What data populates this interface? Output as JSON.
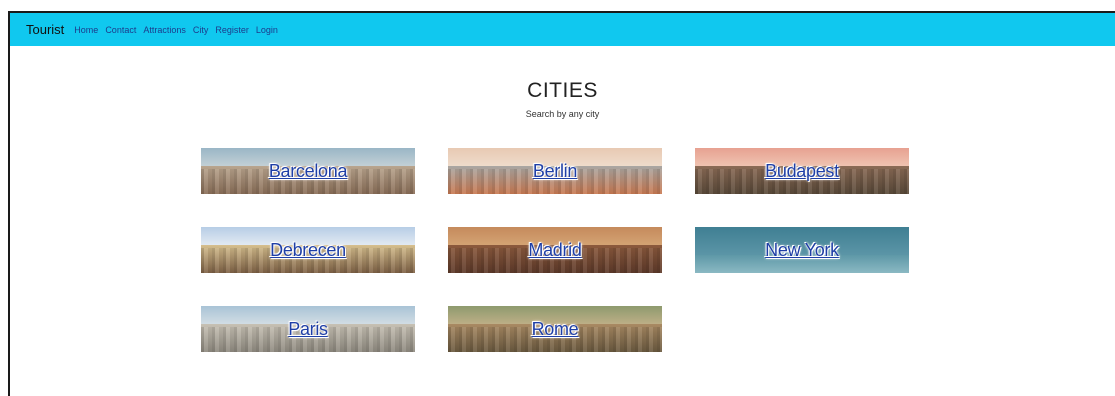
{
  "navbar": {
    "brand": "Tourist",
    "links": [
      "Home",
      "Contact",
      "Attractions",
      "City",
      "Register",
      "Login"
    ]
  },
  "header": {
    "title": "CITIES",
    "subtitle": "Search by any city"
  },
  "cities": [
    {
      "name": "Barcelona"
    },
    {
      "name": "Berlin"
    },
    {
      "name": "Budapest"
    },
    {
      "name": "Debrecen"
    },
    {
      "name": "Madrid"
    },
    {
      "name": "New York"
    },
    {
      "name": "Paris"
    },
    {
      "name": "Rome"
    }
  ],
  "colors": {
    "navbar_bg": "#10c8ef",
    "link": "#1f3fa6"
  }
}
